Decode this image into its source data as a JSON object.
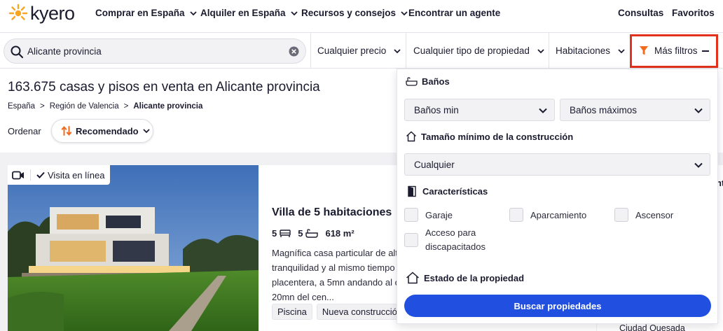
{
  "brand": {
    "name": "kyero",
    "accent": "#f5a623"
  },
  "nav": {
    "links": [
      "Comprar en España",
      "Alquiler en España",
      "Recursos y consejos",
      "Encontrar un agente"
    ],
    "right": [
      "Consultas",
      "Favoritos"
    ]
  },
  "filters": {
    "search_value": "Alicante provincia",
    "price": "Cualquier precio",
    "type": "Cualquier tipo de propiedad",
    "rooms": "Habitaciones",
    "more": "Más filtros"
  },
  "results": {
    "title": "163.675 casas y pisos en venta en Alicante provincia",
    "breadcrumb": [
      "España",
      "Región de Valencia",
      "Alicante provincia"
    ],
    "order_label": "Ordenar",
    "order_value": "Recomendado"
  },
  "listing": {
    "badge": "Visita en línea",
    "title": "Villa de 5 habitaciones",
    "bedrooms": "5",
    "bathrooms": "5",
    "area": "618 m²",
    "description": "Magnífica casa particular de alt tranquilidad y al mismo tiempo placentera, a 5mn andando al c 20mn del cen...",
    "tags": [
      "Piscina",
      "Nueva construcción"
    ]
  },
  "right_card": {
    "peek": "nt",
    "location": "Ciudad Quesada"
  },
  "panel": {
    "banos": {
      "title": "Baños",
      "min": "Baños min",
      "max": "Baños máximos"
    },
    "size": {
      "title": "Tamaño mínimo de la construcción",
      "value": "Cualquier"
    },
    "features": {
      "title": "Características",
      "items": [
        "Garaje",
        "Aparcamiento",
        "Ascensor",
        "Acceso para discapacitados"
      ]
    },
    "estado": {
      "title": "Estado de la propiedad"
    },
    "cta": "Buscar propiedades"
  },
  "colors": {
    "cta": "#2150e0",
    "highlight_border": "#e2311d",
    "filter_icon": "#f26b1d"
  }
}
